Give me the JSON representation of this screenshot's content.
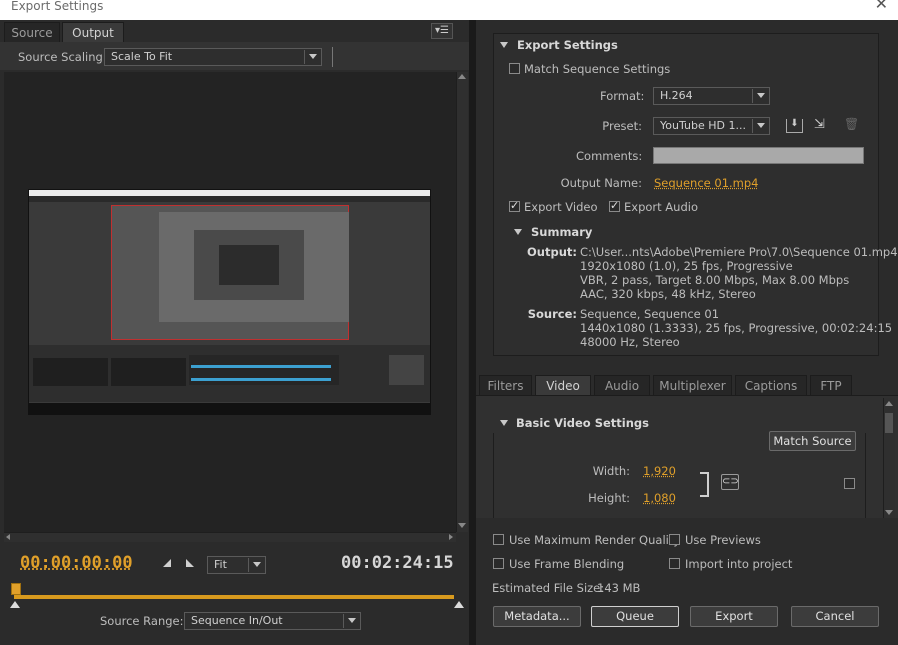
{
  "window": {
    "title": "Export Settings"
  },
  "left": {
    "tabs": [
      "Source",
      "Output"
    ],
    "source_scaling_label": "Source Scaling:",
    "source_scaling_value": "Scale To Fit",
    "timecode_current": "00:00:00:00",
    "timecode_duration": "00:02:24:15",
    "zoom_value": "Fit",
    "source_range_label": "Source Range:",
    "source_range_value": "Sequence In/Out"
  },
  "export_settings": {
    "heading": "Export Settings",
    "match_sequence": "Match Sequence Settings",
    "format_label": "Format:",
    "format_value": "H.264",
    "preset_label": "Preset:",
    "preset_value": "YouTube HD 1...",
    "comments_label": "Comments:",
    "output_name_label": "Output Name:",
    "output_name_value": "Sequence 01.mp4",
    "export_video": "Export Video",
    "export_audio": "Export Audio",
    "summary_heading": "Summary",
    "output_label": "Output:",
    "output_lines": [
      "C:\\User...nts\\Adobe\\Premiere Pro\\7.0\\Sequence 01.mp4",
      "1920x1080 (1.0), 25 fps, Progressive",
      "VBR, 2 pass, Target 8.00 Mbps, Max 8.00 Mbps",
      "AAC, 320 kbps, 48 kHz, Stereo"
    ],
    "source_label": "Source:",
    "source_lines": [
      "Sequence, Sequence 01",
      "1440x1080 (1.3333), 25 fps, Progressive, 00:02:24:15",
      "48000 Hz, Stereo"
    ]
  },
  "settings_tabs": [
    "Filters",
    "Video",
    "Audio",
    "Multiplexer",
    "Captions",
    "FTP"
  ],
  "video": {
    "heading": "Basic Video Settings",
    "match_source": "Match Source",
    "width_label": "Width:",
    "width_value": "1,920",
    "height_label": "Height:",
    "height_value": "1,080"
  },
  "bottom": {
    "max_render": "Use Maximum Render Quality",
    "use_previews": "Use Previews",
    "frame_blending": "Use Frame Blending",
    "import_project": "Import into project",
    "file_size_label": "Estimated File Size:",
    "file_size_value": "143 MB",
    "metadata_btn": "Metadata...",
    "queue_btn": "Queue",
    "export_btn": "Export",
    "cancel_btn": "Cancel"
  },
  "colors": {
    "accent": "#e0a02a",
    "panel": "#2b2b2b",
    "timeline": "#d89a1e"
  }
}
